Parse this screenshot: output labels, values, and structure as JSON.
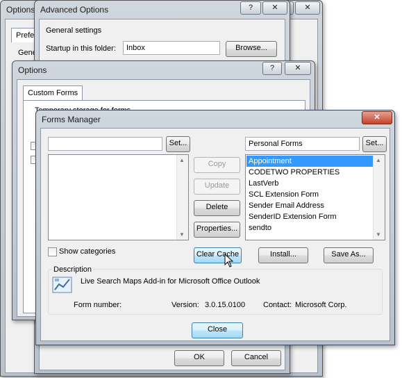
{
  "outer_options": {
    "title": "Options",
    "tab_label": "Prefe",
    "row_label": "Gene",
    "help": "?",
    "close": "✕"
  },
  "advanced_options": {
    "title": "Advanced Options",
    "help": "?",
    "close": "✕",
    "group_label": "General settings",
    "startup_label": "Startup in this folder:",
    "startup_value": "Inbox",
    "browse_label": "Browse...",
    "ok_label": "OK",
    "cancel_label": "Cancel"
  },
  "options": {
    "title": "Options",
    "help": "?",
    "close": "✕",
    "tab_label": "Custom Forms",
    "temp_storage_label": "Temporary storage for forms"
  },
  "forms_manager": {
    "title": "Forms Manager",
    "close": "✕",
    "left_field_value": "",
    "left_set_label": "Set...",
    "right_field_value": "Personal Forms",
    "right_set_label": "Set...",
    "copy_label": "Copy",
    "update_label": "Update",
    "delete_label": "Delete",
    "properties_label": "Properties...",
    "forms": [
      "Appointment",
      "CODETWO PROPERTIES",
      "LastVerb",
      "SCL Extension Form",
      "Sender Email Address",
      "SenderID Extension Form",
      "sendto"
    ],
    "selected_form": "Appointment",
    "show_categories_label": "Show categories",
    "clear_cache_label": "Clear Cache",
    "install_label": "Install...",
    "save_as_label": "Save As...",
    "description_label": "Description",
    "description_text": "Live Search Maps Add-in for Microsoft Office Outlook",
    "form_number_label": "Form number:",
    "version_label": "Version:",
    "version_value": "3.0.15.0100",
    "contact_label": "Contact:",
    "contact_value": "Microsoft Corp.",
    "close_label": "Close",
    "form_icon": "form-icon"
  }
}
